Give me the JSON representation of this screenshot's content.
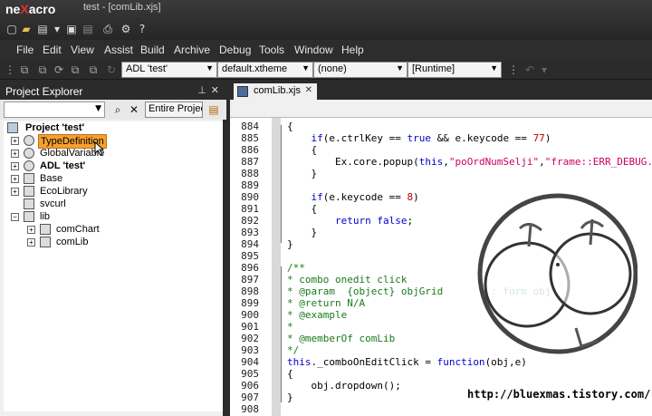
{
  "app": {
    "logo_pre": "ne",
    "logo_x": "X",
    "logo_post": "acro",
    "window_title": "test - [comLib.xjs]"
  },
  "menu": [
    "File",
    "Edit",
    "View",
    "Assist",
    "Build",
    "Archive",
    "Debug",
    "Tools",
    "Window",
    "Help"
  ],
  "toolbar": {
    "adl": "ADL 'test'",
    "theme": "default.xtheme",
    "none": "(none)",
    "runtime": "[Runtime]"
  },
  "explorer": {
    "title": "Project Explorer",
    "scope": "Entire Project",
    "tree": {
      "root": "Project 'test'",
      "typedef": "TypeDefinition",
      "globalvar": "GlobalVariable",
      "adl": "ADL 'test'",
      "base": "Base",
      "ecolib": "EcoLibrary",
      "svcurl": "svcurl",
      "lib": "lib",
      "comchart": "comChart",
      "comlib": "comLib"
    }
  },
  "editor": {
    "tab": "comLib.xjs",
    "line_numbers": [
      "884",
      "885",
      "886",
      "887",
      "888",
      "889",
      "890",
      "891",
      "892",
      "893",
      "894",
      "895",
      "896",
      "897",
      "898",
      "899",
      "900",
      "901",
      "902",
      "903",
      "904",
      "905",
      "906",
      "907",
      "908"
    ],
    "lines": {
      "l884": "{",
      "l885_a": "    if",
      "l885_b": "(e.ctrlKey == ",
      "l885_c": "true",
      "l885_d": " && e.keycode == ",
      "l885_e": "77",
      "l885_f": ")",
      "l886": "    {",
      "l887_a": "        Ex.core.popup(",
      "l887_b": "this",
      "l887_c": ",",
      "l887_d": "\"poOrdNumSelji\"",
      "l887_e": "\"frame::ERR_DEBUG.xfdl\"",
      "l888": "    }",
      "l890_a": "    if",
      "l890_b": "(e.keycode == ",
      "l890_c": "8",
      "l890_d": ")",
      "l891": "    {",
      "l892_a": "        return",
      "l892_b": " false",
      "l892_c": ";",
      "l893": "    }",
      "l894": "}",
      "l896": "/**",
      "l897": "* combo onedit click",
      "l898": "* @param  {object} objGrid        : form obj",
      "l899": "* @return N/A",
      "l900": "* @example",
      "l901": "*",
      "l902": "* @memberOf comLib",
      "l903": "*/",
      "l904_a": "this",
      "l904_b": "._comboOnEditClick = ",
      "l904_c": "function",
      "l904_d": "(obj,e)",
      "l905": "{",
      "l906": "    obj.dropdown();",
      "l907": "}"
    }
  },
  "watermark": {
    "url": "http://bluexmas.tistory.com/"
  },
  "colors": {
    "keyword": "#0000cc",
    "number": "#c00000",
    "string": "#cc0066",
    "comment": "#1a7a1a",
    "accent": "#e03030"
  }
}
